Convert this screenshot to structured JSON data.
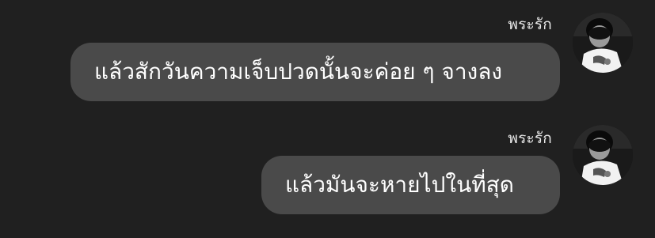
{
  "messages": [
    {
      "sender": "พระรัก",
      "text": "แล้วสักวันความเจ็บปวดนั้นจะค่อย ๆ จางลง",
      "avatar_icon": "profile-photo-avatar"
    },
    {
      "sender": "พระรัก",
      "text": "แล้วมันจะหายไปในที่สุด",
      "avatar_icon": "profile-photo-avatar"
    }
  ],
  "colors": {
    "background": "#202020",
    "bubble": "#4a4a4a",
    "text": "#ffffff"
  }
}
